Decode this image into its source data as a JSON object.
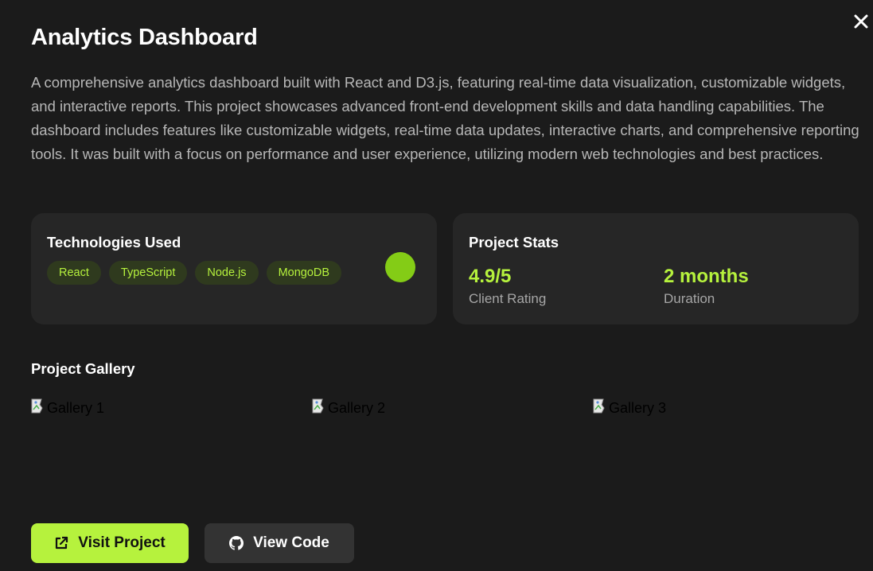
{
  "modal": {
    "title": "Analytics Dashboard",
    "description": "A comprehensive analytics dashboard built with React and D3.js, featuring real-time data visualization, customizable widgets, and interactive reports. This project showcases advanced front-end development skills and data handling capabilities. The dashboard includes features like customizable widgets, real-time data updates, interactive charts, and comprehensive reporting tools. It was built with a focus on performance and user experience, utilizing modern web technologies and best practices.",
    "close_icon": "close-icon"
  },
  "technologies": {
    "title": "Technologies Used",
    "tags": [
      "React",
      "TypeScript",
      "Node.js",
      "MongoDB"
    ],
    "status_color": "#84cc16"
  },
  "stats": {
    "title": "Project Stats",
    "rating": {
      "value": "4.9/5",
      "label": "Client Rating"
    },
    "duration": {
      "value": "2 months",
      "label": "Duration"
    }
  },
  "gallery": {
    "title": "Project Gallery",
    "items": [
      {
        "alt": "Gallery 1"
      },
      {
        "alt": "Gallery 2"
      },
      {
        "alt": "Gallery 3"
      }
    ]
  },
  "actions": {
    "visit": {
      "label": "Visit Project",
      "icon": "external-link-icon"
    },
    "code": {
      "label": "View Code",
      "icon": "github-icon"
    }
  },
  "colors": {
    "accent": "#b6f23d",
    "background": "#1b1b1b",
    "card": "#262626"
  }
}
